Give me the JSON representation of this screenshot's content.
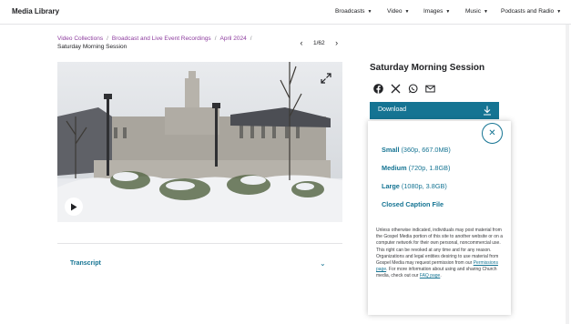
{
  "header": {
    "brand": "Media Library",
    "nav": [
      {
        "label": "Broadcasts"
      },
      {
        "label": "Video"
      },
      {
        "label": "Images"
      },
      {
        "label": "Music"
      },
      {
        "label": "Podcasts and Radio"
      }
    ]
  },
  "breadcrumb": {
    "items": [
      "Video Collections",
      "Broadcast and Live Event Recordings",
      "April 2024"
    ],
    "current": "Saturday Morning Session"
  },
  "pager": {
    "text": "1/62"
  },
  "media": {
    "title": "Saturday Morning Session",
    "share_icons": [
      "facebook-icon",
      "x-icon",
      "whatsapp-icon",
      "email-icon"
    ]
  },
  "download": {
    "label": "Download",
    "options": [
      {
        "name": "Small",
        "detail": "(360p, 667.0MB)"
      },
      {
        "name": "Medium",
        "detail": "(720p, 1.8GB)"
      },
      {
        "name": "Large",
        "detail": "(1080p, 3.8GB)"
      },
      {
        "name": "Closed Caption File",
        "detail": ""
      }
    ],
    "legal_text": "Unless otherwise indicated, individuals may post material from the Gospel Media portion of this site to another website or on a computer network for their own personal, noncommercial use. This right can be revoked at any time and for any reason. Organizations and legal entities desiring to use material from Gospel Media may request permission from our",
    "legal_link1": "Permissions page",
    "legal_text2": ". For more information about using and sharing Church media, check out our",
    "legal_link2": "FAQ page",
    "legal_end": "."
  },
  "background_fragments": {
    "a": "n",
    "b": "ts"
  },
  "transcript": {
    "label": "Transcript"
  },
  "colors": {
    "accent": "#157493",
    "link": "#8d3c9e"
  }
}
